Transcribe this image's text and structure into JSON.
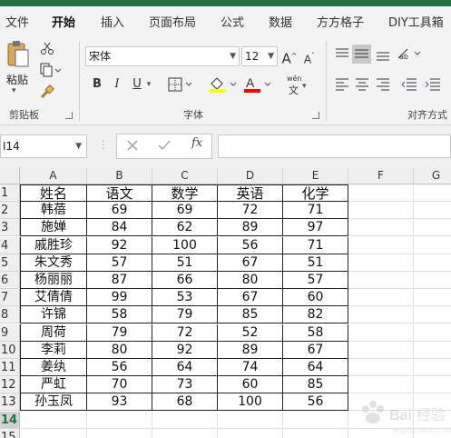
{
  "ribbon_tabs": [
    {
      "label": "文件"
    },
    {
      "label": "开始"
    },
    {
      "label": "插入"
    },
    {
      "label": "页面布局"
    },
    {
      "label": "公式"
    },
    {
      "label": "数据"
    },
    {
      "label": "方方格子"
    },
    {
      "label": "DIY工具箱"
    }
  ],
  "clipboard": {
    "paste_label": "粘贴",
    "group_label": "剪贴板"
  },
  "font": {
    "name": "宋体",
    "size": "12",
    "group_label": "字体",
    "phonetic_label": "wén"
  },
  "alignment": {
    "group_label": "对齐方式"
  },
  "icons": {
    "cut": "scissors-icon",
    "copy": "copy-icon",
    "format_painter": "brush-icon",
    "grow": "font-grow-icon",
    "shrink": "font-shrink-icon",
    "border": "border-icon",
    "fill": "fill-color-icon",
    "font_color": "font-color-icon",
    "phonetic": "phonetic-icon"
  },
  "colors": {
    "accent": "#217346",
    "fill_color": "#ffff00",
    "font_color": "#ff0000"
  },
  "formula_bar": {
    "name_box": "I14",
    "fx_label": "fx",
    "formula": ""
  },
  "columns": [
    "A",
    "B",
    "C",
    "D",
    "E",
    "F",
    "G"
  ],
  "rows": [
    "1",
    "2",
    "3",
    "4",
    "5",
    "6",
    "7",
    "8",
    "9",
    "10",
    "11",
    "12",
    "13",
    "14",
    "15"
  ],
  "active_cell": {
    "row": "14",
    "column": "I"
  },
  "headers": [
    "姓名",
    "语文",
    "数学",
    "英语",
    "化学"
  ],
  "table": [
    [
      "韩蓓",
      "69",
      "69",
      "72",
      "71"
    ],
    [
      "施婵",
      "84",
      "62",
      "89",
      "97"
    ],
    [
      "戚胜珍",
      "92",
      "100",
      "56",
      "71"
    ],
    [
      "朱文秀",
      "57",
      "51",
      "67",
      "51"
    ],
    [
      "杨丽丽",
      "87",
      "66",
      "80",
      "57"
    ],
    [
      "艾倩倩",
      "99",
      "53",
      "67",
      "60"
    ],
    [
      "许锦",
      "58",
      "79",
      "85",
      "82"
    ],
    [
      "周荷",
      "79",
      "72",
      "52",
      "58"
    ],
    [
      "李莉",
      "80",
      "92",
      "89",
      "67"
    ],
    [
      "姜纨",
      "56",
      "64",
      "74",
      "64"
    ],
    [
      "严虹",
      "70",
      "73",
      "60",
      "85"
    ],
    [
      "孙玉凤",
      "93",
      "68",
      "100",
      "56"
    ]
  ]
}
